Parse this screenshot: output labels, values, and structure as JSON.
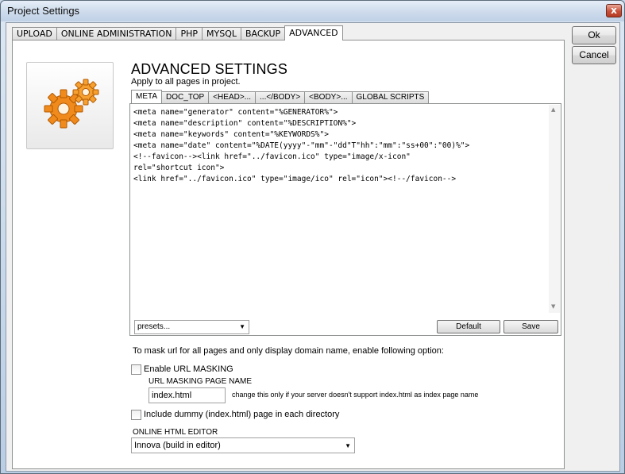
{
  "window": {
    "title": "Project Settings",
    "close_glyph": "x"
  },
  "tabs": [
    "UPLOAD",
    "ONLINE ADMINISTRATION",
    "PHP",
    "MYSQL",
    "BACKUP",
    "ADVANCED"
  ],
  "active_tab": "ADVANCED",
  "buttons": {
    "ok": "Ok",
    "cancel": "Cancel"
  },
  "header": {
    "icon": "gears-icon",
    "title": "ADVANCED SETTINGS",
    "subtitle": "Apply to all pages in project."
  },
  "subtabs": [
    "META",
    "DOC_TOP",
    "<HEAD>...",
    "...</BODY>",
    "<BODY>...",
    "GLOBAL SCRIPTS"
  ],
  "active_subtab": "META",
  "editor": {
    "code": "<meta name=\"generator\" content=\"%GENERATOR%\">\n<meta name=\"description\" content=\"%DESCRIPTION%\">\n<meta name=\"keywords\" content=\"%KEYWORDS%\">\n<meta name=\"date\" content=\"%DATE(yyyy\"-\"mm\"-\"dd\"T\"hh\":\"mm\":\"ss+00\":\"00)%\">\n<!--favicon--><link href=\"../favicon.ico\" type=\"image/x-icon\"\nrel=\"shortcut icon\">\n<link href=\"../favicon.ico\" type=\"image/ico\" rel=\"icon\"><!--/favicon-->",
    "presets_value": "presets...",
    "default_label": "Default",
    "save_label": "Save"
  },
  "url_masking": {
    "intro": "To mask url for all pages and only display domain name, enable following option:",
    "enable_label": "Enable URL MASKING",
    "enable_checked": false,
    "page_name_label": "URL MASKING PAGE NAME",
    "page_name_value": "index.html",
    "page_name_hint": "change this only if your server doesn't support index.html as index page name",
    "dummy_label": "Include dummy (index.html) page in each directory",
    "dummy_checked": false
  },
  "html_editor": {
    "label": "ONLINE HTML EDITOR",
    "value": "Innova (build in editor)"
  },
  "colors": {
    "titlebar": "#cfdcec",
    "close_button": "#c8503a",
    "gear": "#f08a1c"
  }
}
